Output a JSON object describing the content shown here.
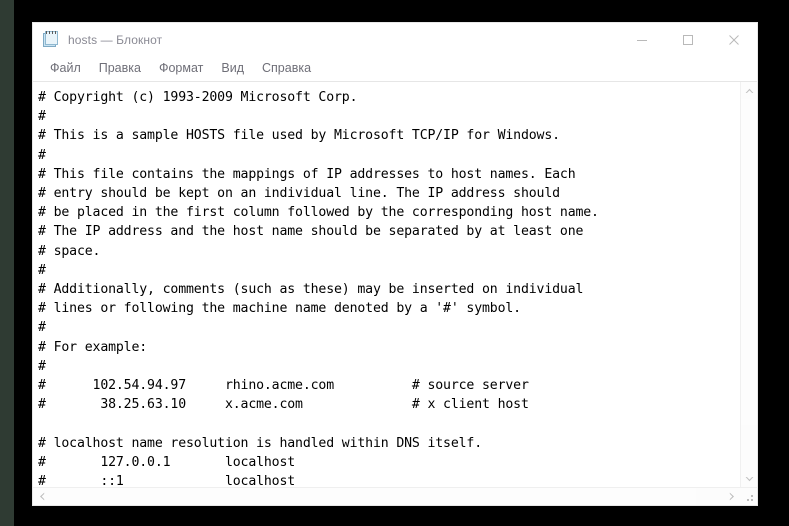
{
  "window": {
    "title": "hosts — Блокнот",
    "app_icon": "notepad-icon"
  },
  "titlebar": {
    "minimize_label": "—",
    "maximize_label": "□",
    "close_label": "✕"
  },
  "menu": {
    "items": [
      {
        "label": "Файл"
      },
      {
        "label": "Правка"
      },
      {
        "label": "Формат"
      },
      {
        "label": "Вид"
      },
      {
        "label": "Справка"
      }
    ]
  },
  "editor": {
    "content": "# Copyright (c) 1993-2009 Microsoft Corp.\n#\n# This is a sample HOSTS file used by Microsoft TCP/IP for Windows.\n#\n# This file contains the mappings of IP addresses to host names. Each\n# entry should be kept on an individual line. The IP address should\n# be placed in the first column followed by the corresponding host name.\n# The IP address and the host name should be separated by at least one\n# space.\n#\n# Additionally, comments (such as these) may be inserted on individual\n# lines or following the machine name denoted by a '#' symbol.\n#\n# For example:\n#\n#      102.54.94.97     rhino.acme.com          # source server\n#       38.25.63.10     x.acme.com              # x client host\n\n# localhost name resolution is handled within DNS itself.\n#       127.0.0.1       localhost\n#       ::1             localhost"
  },
  "scrollbars": {
    "vertical": {
      "up_icon": "chevron-up-icon",
      "down_icon": "chevron-down-icon"
    },
    "horizontal": {
      "left_icon": "chevron-left-icon",
      "right_icon": "chevron-right-icon"
    },
    "resize_grip": "resize-grip-icon"
  },
  "colors": {
    "window_bg": "#ffffff",
    "text": "#000000",
    "title_text": "#8a8a94",
    "menu_text": "#6f6f78",
    "scrollbar_arrow": "#c0c0c0",
    "desktop_bg": "#000000"
  }
}
